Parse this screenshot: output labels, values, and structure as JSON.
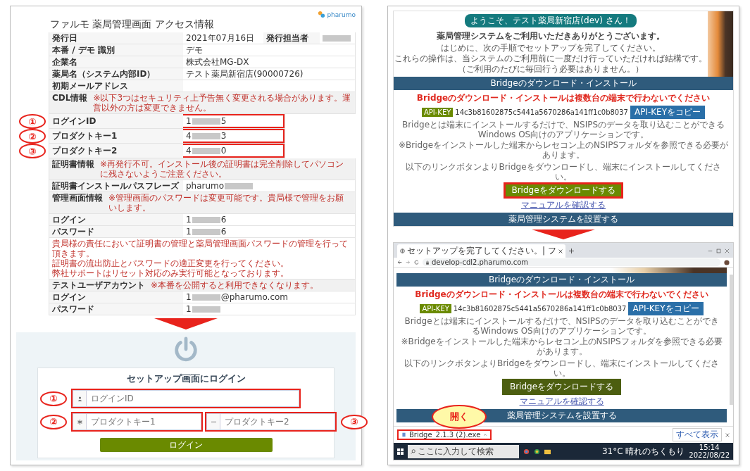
{
  "left_document": {
    "brand": "pharumo",
    "title": "ファルモ 薬局管理画面 アクセス情報",
    "rows": [
      {
        "kind": "field",
        "label": "発行日",
        "value": {
          "prefix": "2021年07月16日",
          "redacted": false
        },
        "extra_label": "発行担当者",
        "extra_value": {
          "redacted": true
        },
        "highlighted": false
      },
      {
        "kind": "field",
        "label": "本番 / デモ 識別",
        "value": {
          "prefix": "デモ",
          "redacted": false
        },
        "highlighted": false
      },
      {
        "kind": "field",
        "label": "企業名",
        "value": {
          "prefix": "株式会社MG-DX",
          "redacted": false
        },
        "highlighted": false
      },
      {
        "kind": "field",
        "label": "薬局名（システム内部ID）",
        "value": {
          "prefix": "テスト薬局新宿店(90000726)",
          "redacted": false
        },
        "highlighted": false
      },
      {
        "kind": "field",
        "label": "初期メールアドレス",
        "value": {
          "redacted": false
        },
        "highlighted": false
      },
      {
        "kind": "section",
        "label": "CDL情報",
        "note": "※以下3つはセキュリティ上予告無く変更される場合があります。運営以外の方は変更できません。"
      },
      {
        "kind": "field",
        "label": "ログインID",
        "value": {
          "prefix": "1",
          "suffix": "5",
          "redacted": true
        },
        "highlighted": true,
        "callout": "①"
      },
      {
        "kind": "field",
        "label": "プロダクトキー1",
        "value": {
          "prefix": "4",
          "suffix": "3",
          "redacted": true
        },
        "highlighted": true,
        "callout": "②"
      },
      {
        "kind": "field",
        "label": "プロダクトキー2",
        "value": {
          "prefix": "4",
          "suffix": "0",
          "redacted": true
        },
        "highlighted": true,
        "callout": "③"
      },
      {
        "kind": "section",
        "label": "証明書情報",
        "note": "※再発行不可。インストール後の証明書は完全削除してパソコンに残さないようご注意ください。"
      },
      {
        "kind": "field",
        "label": "証明書インストールパスフレーズ",
        "value": {
          "prefix": "pharumo",
          "redacted": true
        },
        "highlighted": false
      },
      {
        "kind": "section",
        "label": "管理画面情報",
        "note": "※管理画面のパスワードは変更可能です。貴局様で管理をお願いします。"
      },
      {
        "kind": "field",
        "label": "ログイン",
        "value": {
          "prefix": "1",
          "suffix": "6",
          "redacted": true
        },
        "highlighted": false
      },
      {
        "kind": "field",
        "label": "パスワード",
        "value": {
          "prefix": "1",
          "suffix": "6",
          "redacted": true
        },
        "highlighted": false
      },
      {
        "kind": "note",
        "lines": [
          "貴局様の責任において証明書の管理と薬局管理画面パスワードの管理を行って頂きます。",
          "証明書の流出防止とパスワードの適正変更を行ってください。",
          "弊社サポートはリセット対応のみ実行可能となっております。"
        ]
      },
      {
        "kind": "section",
        "label": "テストユーザアカウント",
        "note": "※本番を公開すると利用できなくなります。"
      },
      {
        "kind": "field",
        "label": "ログイン",
        "value": {
          "prefix": "1",
          "suffix": "@pharumo.com",
          "redacted": true
        },
        "highlighted": false
      },
      {
        "kind": "field",
        "label": "パスワード",
        "value": {
          "prefix": "1",
          "redacted": true
        },
        "highlighted": false
      }
    ]
  },
  "login_screen": {
    "title": "セットアップ画面にログイン",
    "fields": [
      {
        "placeholder": "ログインID",
        "highlighted": true,
        "callout": "①"
      },
      {
        "placeholder": "プロダクトキー1",
        "highlighted": true,
        "callout": "②"
      },
      {
        "placeholder": "プロダクトキー2",
        "highlighted": true,
        "callout": "③"
      }
    ],
    "button": "ログイン"
  },
  "setup_page": {
    "welcome": "ようこそ、テスト薬局新宿店(dev) さん！",
    "thanks": "薬局管理システムをご利用いただきありがとうございます。",
    "intro_lines": [
      "はじめに、次の手順でセットアップを完了してください。",
      "これらの操作は、当システムのご利用前に一度だけ行っていただければ結構です。",
      "（ご利用のたびに毎回行う必要はありません。）"
    ],
    "section_title": "Bridgeのダウンロード・インストール",
    "warning": "Bridgeのダウンロード・インストールは複数台の端末で行わないでください",
    "api_key_label": "API-KEY",
    "api_key": "14c3b81602875c5441a5670286a141ff1c0b8037",
    "copy_button": "API-KEYをコピー",
    "description_lines": [
      "Bridgeとは端末にインストールするだけで、NSIPSのデータを取り込むことができるWindows OS向けのアプリケーションです。",
      "※Bridgeをインストールした端末からレセコン上のNSIPSフォルダを参照できる必要があります。"
    ],
    "instruction": "以下のリンクボタンよりBridgeをダウンロードし、端末にインストールしてください。",
    "download_button": {
      "label": "Bridgeをダウンロードする",
      "highlighted": true
    },
    "manual_link": "マニュアルを確認する",
    "next_section_title": "薬局管理システムを設置する"
  },
  "browser": {
    "tab_title": "セットアップを完了してください。| フ",
    "url": "develop-cdl2.pharumo.com",
    "page": {
      "section_title": "Bridgeのダウンロード・インストール",
      "warning": "Bridgeのダウンロード・インストールは複数台の端末で行わないでください",
      "api_key_label": "API-KEY",
      "api_key": "14c3b81602875c5441a5670286a141ff1c0b8037",
      "copy_button": "API-KEYをコピー",
      "description_lines": [
        "Bridgeとは端末にインストールするだけで、NSIPSのデータを取り込むことができるWindows OS向けのアプリケーションです。",
        "※Bridgeをインストールした端末からレセコン上のNSIPSフォルダを参照できる必要があります。"
      ],
      "instruction": "以下のリンクボタンよりBridgeをダウンロードし、端末にインストールしてください。",
      "download_button": {
        "label": "Bridgeをダウンロードする",
        "highlighted": false
      },
      "manual_link": "マニュアルを確認する",
      "next_section_title": "薬局管理システムを設置する"
    },
    "callout": "開く",
    "download": {
      "file": "Bridge_2.1.3 (2).exe",
      "highlighted": true
    },
    "show_all": "すべて表示",
    "taskbar": {
      "search_placeholder": "ここに入力して検索",
      "weather": "31°C 晴れのちくもり",
      "time": "15:14",
      "date": "2022/08/22"
    }
  }
}
